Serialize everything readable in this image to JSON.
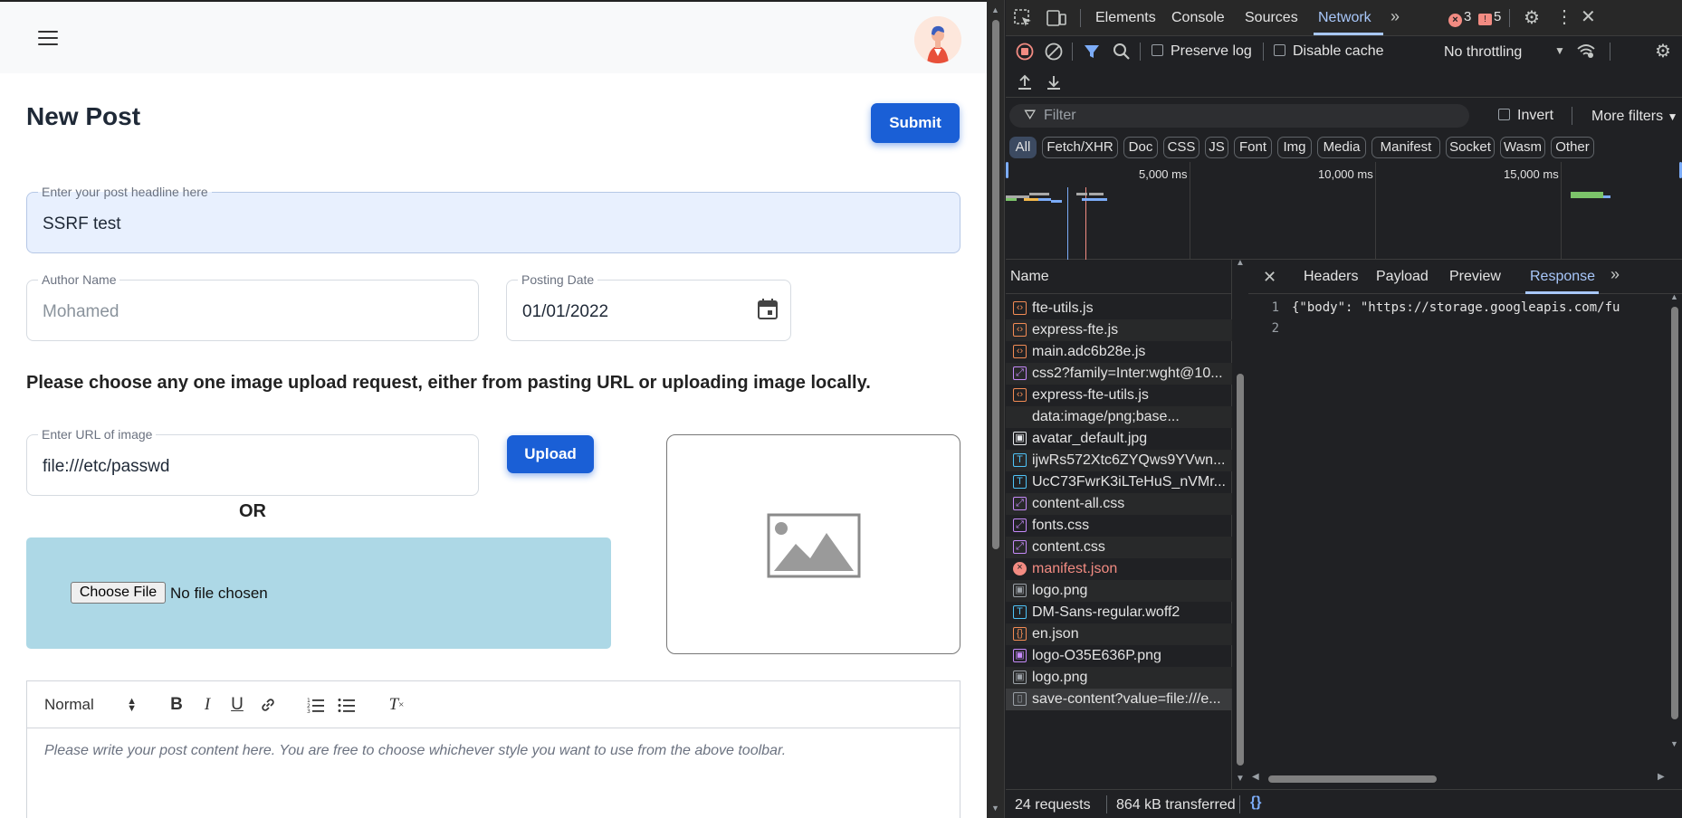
{
  "app": {
    "title": "New Post",
    "submit_label": "Submit",
    "headline": {
      "label": "Enter your post headline here",
      "value": "SSRF test"
    },
    "author": {
      "label": "Author Name",
      "placeholder": "Mohamed"
    },
    "date": {
      "label": "Posting Date",
      "value": "01/01/2022"
    },
    "instructions": "Please choose any one image upload request, either from pasting URL or uploading image locally.",
    "url_field": {
      "label": "Enter URL of image",
      "value": "file:///etc/passwd"
    },
    "upload_label": "Upload",
    "or_label": "OR",
    "choose_file_label": "Choose File",
    "no_file_label": "No file chosen",
    "editor": {
      "format_value": "Normal",
      "placeholder": "Please write your post content here. You are free to choose whichever style you want to use from the above toolbar."
    }
  },
  "devtools": {
    "tabs": [
      "Elements",
      "Console",
      "Sources",
      "Network"
    ],
    "active_tab": "Network",
    "error_count": "3",
    "warning_count": "5",
    "preserve_log": "Preserve log",
    "disable_cache": "Disable cache",
    "throttling": "No throttling",
    "filter_placeholder": "Filter",
    "invert_label": "Invert",
    "more_filters": "More filters",
    "type_filters": [
      "All",
      "Fetch/XHR",
      "Doc",
      "CSS",
      "JS",
      "Font",
      "Img",
      "Media",
      "Manifest",
      "Socket",
      "Wasm",
      "Other"
    ],
    "timeline_labels": [
      "5,000 ms",
      "10,000 ms",
      "15,000 ms"
    ],
    "name_header": "Name",
    "requests": [
      {
        "name": "fte-utils.js",
        "icon": "script-icon",
        "color": "#f28b54"
      },
      {
        "name": "express-fte.js",
        "icon": "script-icon",
        "color": "#f28b54"
      },
      {
        "name": "main.adc6b28e.js",
        "icon": "script-icon",
        "color": "#f28b54"
      },
      {
        "name": "css2?family=Inter:wght@10...",
        "icon": "stylesheet-icon",
        "color": "#c58af9"
      },
      {
        "name": "express-fte-utils.js",
        "icon": "script-icon",
        "color": "#f28b54"
      },
      {
        "name": "data:image/png;base...",
        "icon": "none",
        "color": "#202124"
      },
      {
        "name": "avatar_default.jpg",
        "icon": "image-icon",
        "color": "#e8eaed"
      },
      {
        "name": "ijwRs572Xtc6ZYQws9YVwn...",
        "icon": "font-icon",
        "color": "#4fc3f7"
      },
      {
        "name": "UcC73FwrK3iLTeHuS_nVMr...",
        "icon": "font-icon",
        "color": "#4fc3f7"
      },
      {
        "name": "content-all.css",
        "icon": "stylesheet-icon",
        "color": "#c58af9"
      },
      {
        "name": "fonts.css",
        "icon": "stylesheet-icon",
        "color": "#c58af9"
      },
      {
        "name": "content.css",
        "icon": "stylesheet-icon",
        "color": "#c58af9"
      },
      {
        "name": "manifest.json",
        "icon": "error-icon",
        "color": "#f28b82",
        "error": true
      },
      {
        "name": "logo.png",
        "icon": "image-icon",
        "color": "#9aa0a6"
      },
      {
        "name": "DM-Sans-regular.woff2",
        "icon": "font-icon",
        "color": "#4fc3f7"
      },
      {
        "name": "en.json",
        "icon": "json-icon",
        "color": "#f28b54"
      },
      {
        "name": "logo-O35E636P.png",
        "icon": "image-icon",
        "color": "#c58af9"
      },
      {
        "name": "logo.png",
        "icon": "image-icon",
        "color": "#9aa0a6"
      },
      {
        "name": "save-content?value=file:///e...",
        "icon": "document-icon",
        "color": "#9aa0a6"
      }
    ],
    "detail_tabs": [
      "Headers",
      "Payload",
      "Preview",
      "Response"
    ],
    "active_detail_tab": "Response",
    "response_lines": [
      "{\"body\": \"https://storage.googleapis.com/fu",
      ""
    ],
    "status": {
      "requests": "24 requests",
      "transferred": "864 kB transferred"
    },
    "colors": {
      "accent": "#a8c7fa",
      "background": "#202124"
    }
  }
}
